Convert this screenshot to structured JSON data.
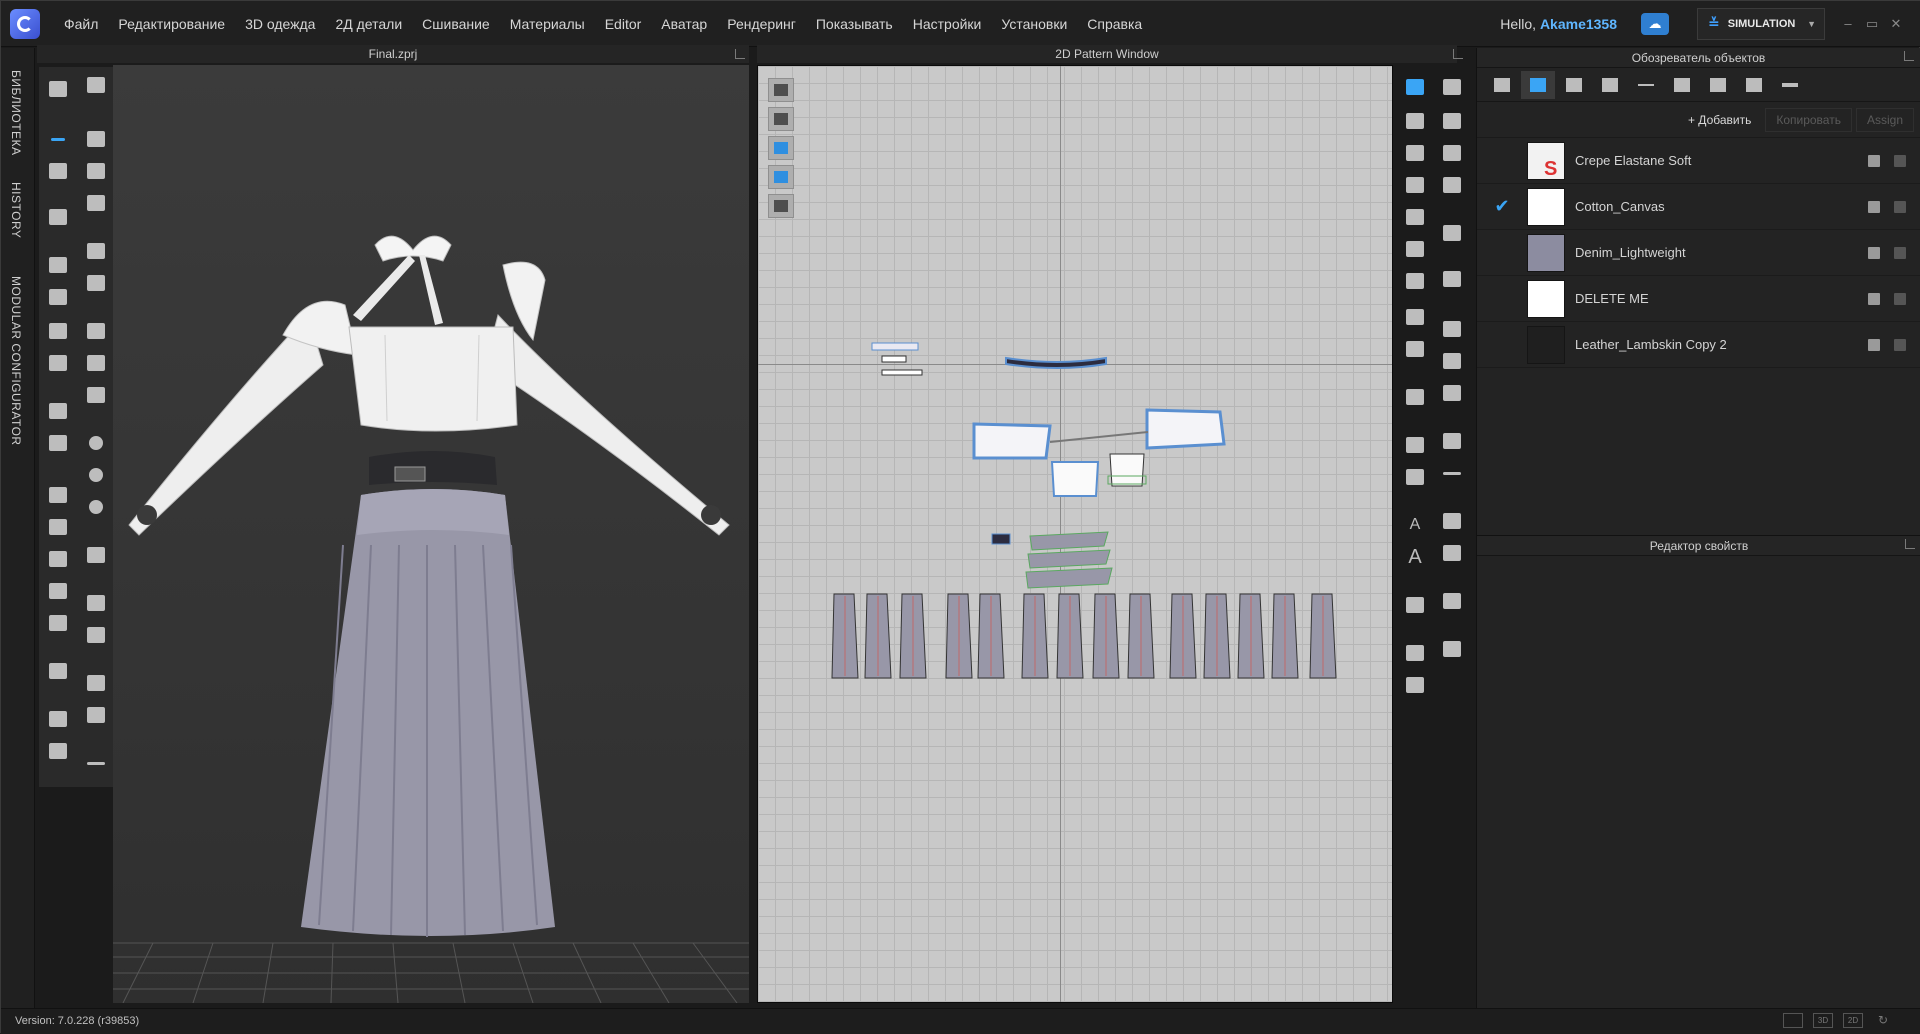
{
  "menubar": {
    "items": [
      "Файл",
      "Редактирование",
      "3D одежда",
      "2Д детали",
      "Сшивание",
      "Материалы",
      "Editor",
      "Аватар",
      "Рендеринг",
      "Показывать",
      "Настройки",
      "Установки",
      "Справка"
    ],
    "hello_prefix": "Hello, ",
    "username": "Akame1358",
    "mode_label": "SIMULATION"
  },
  "left_tabs": [
    "БИБЛИОТЕКА",
    "HISTORY",
    "MODULAR CONFIGURATOR"
  ],
  "viewport3d": {
    "title": "Final.zprj"
  },
  "viewport2d": {
    "title": "2D Pattern Window"
  },
  "object_browser": {
    "title": "Обозреватель объектов",
    "add_label": "+ Добавить",
    "copy_label": "Копировать",
    "assign_label": "Assign",
    "materials": [
      {
        "name": "Crepe Elastane Soft",
        "checked": false,
        "swatch": "#f2f2f2"
      },
      {
        "name": "Cotton_Canvas",
        "checked": true,
        "swatch": "#ffffff"
      },
      {
        "name": "Denim_Lightweight",
        "checked": false,
        "swatch": "#8c8ca0"
      },
      {
        "name": "DELETE ME",
        "checked": false,
        "swatch": "#ffffff"
      },
      {
        "name": "Leather_Lambskin Copy 2",
        "checked": false,
        "swatch": "#1f1f1f"
      }
    ],
    "check_glyph": "✔"
  },
  "property_editor": {
    "title": "Редактор свойств"
  },
  "status": {
    "version": "Version: 7.0.228 (r39853)",
    "views": [
      "3D",
      "2D"
    ]
  }
}
